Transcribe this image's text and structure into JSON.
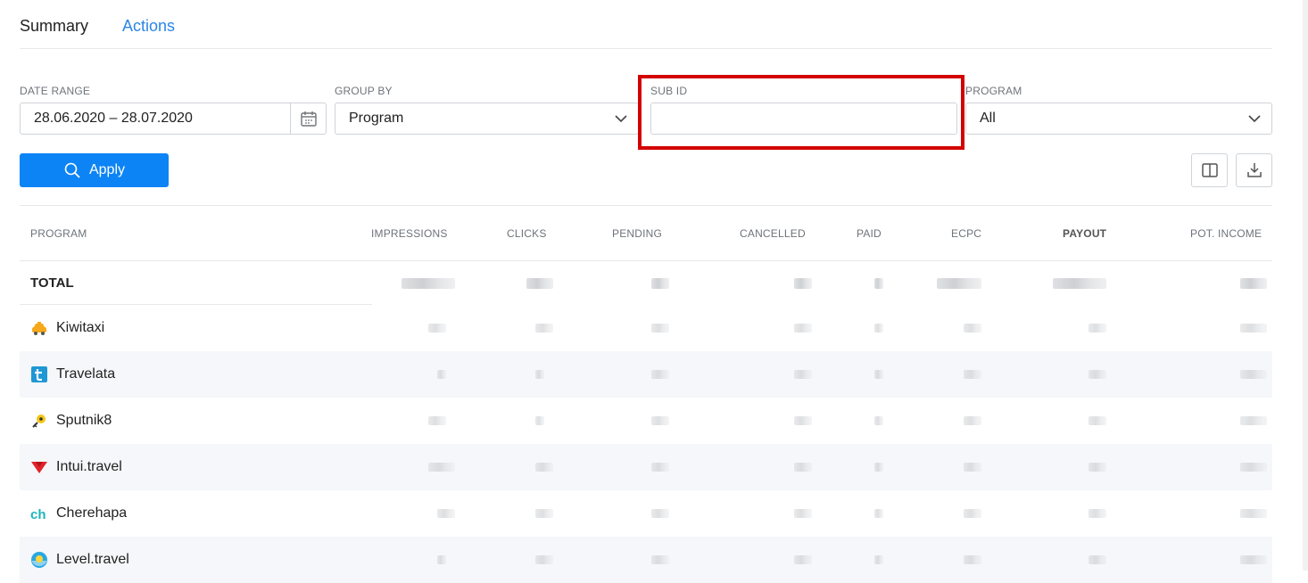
{
  "tabs": [
    {
      "label": "Summary"
    },
    {
      "label": "Actions"
    }
  ],
  "filters": {
    "date_range": {
      "label": "DATE RANGE",
      "value": "28.06.2020 – 28.07.2020"
    },
    "group_by": {
      "label": "GROUP BY",
      "value": "Program"
    },
    "sub_id": {
      "label": "SUB ID",
      "value": "",
      "placeholder": ""
    },
    "program": {
      "label": "PROGRAM",
      "value": "All"
    }
  },
  "apply_label": "Apply",
  "table": {
    "headers": [
      "PROGRAM",
      "IMPRESSIONS",
      "CLICKS",
      "PENDING",
      "CANCELLED",
      "PAID",
      "ECPC",
      "PAYOUT",
      "POT. INCOME"
    ],
    "total_label": "TOTAL",
    "rows": [
      {
        "name": "Kiwitaxi"
      },
      {
        "name": "Travelata"
      },
      {
        "name": "Sputnik8"
      },
      {
        "name": "Intui.travel"
      },
      {
        "name": "Cherehapa"
      },
      {
        "name": "Level.travel"
      }
    ]
  },
  "colors": {
    "accent": "#0d84f5",
    "tab_active": "#2b86e8",
    "highlight": "#d40000"
  },
  "icons": [
    "calendar-icon",
    "chevron-down-icon",
    "search-icon",
    "columns-icon",
    "download-icon"
  ]
}
